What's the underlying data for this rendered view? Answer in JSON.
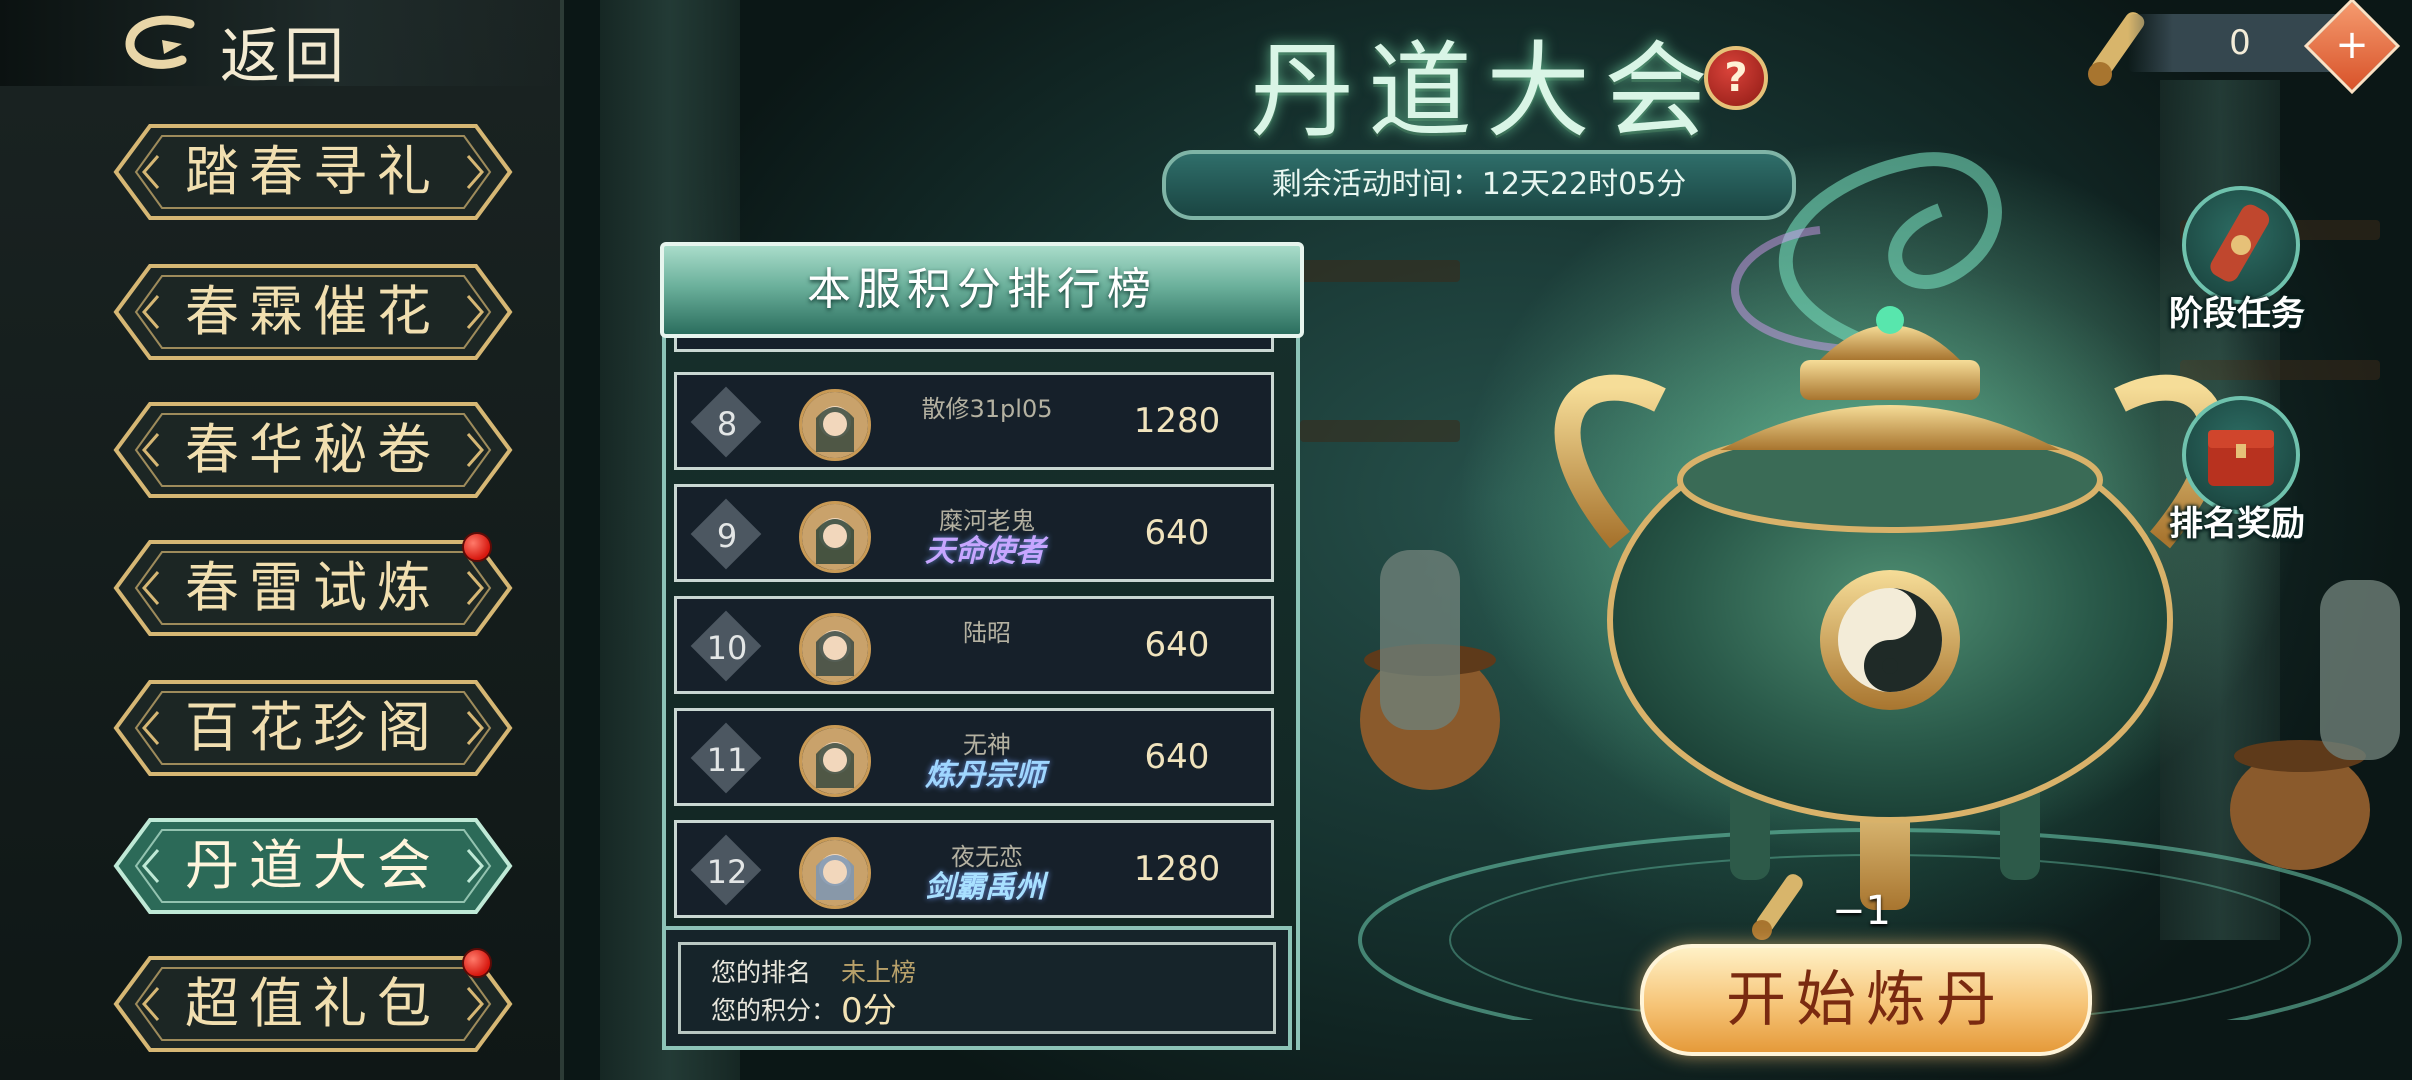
{
  "colors": {
    "accent_gold": "#e7c27a",
    "panel_teal": "#6cb19c",
    "notify_red": "#d7180f",
    "start_orange": "#f6c477"
  },
  "back": {
    "label": "返回"
  },
  "menu": [
    {
      "label": "踏春寻礼",
      "active": false,
      "badge": false
    },
    {
      "label": "春霖催花",
      "active": false,
      "badge": false
    },
    {
      "label": "春华秘卷",
      "active": false,
      "badge": false
    },
    {
      "label": "春雷试炼",
      "active": false,
      "badge": true
    },
    {
      "label": "百花珍阁",
      "active": false,
      "badge": false
    },
    {
      "label": "丹道大会",
      "active": true,
      "badge": false
    },
    {
      "label": "超值礼包",
      "active": false,
      "badge": true
    }
  ],
  "event": {
    "title": "丹道大会",
    "help": "?",
    "timer": "剩余活动时间：12天22时05分"
  },
  "currency": {
    "value": "0",
    "add_symbol": "+",
    "icon": "elixir-scroll-icon"
  },
  "side_buttons": {
    "stage_tasks": "阶段任务",
    "rank_rewards": "排名奖励"
  },
  "ranking": {
    "title": "本服积分排行榜",
    "rows": [
      {
        "rank": "8",
        "name": "散修31pl05",
        "title_badge": "",
        "score": "1280"
      },
      {
        "rank": "9",
        "name": "糜河老鬼",
        "title_badge": "天命使者",
        "score": "640"
      },
      {
        "rank": "10",
        "name": "陆昭",
        "title_badge": "",
        "score": "640"
      },
      {
        "rank": "11",
        "name": "无神",
        "title_badge": "炼丹宗师",
        "score": "640"
      },
      {
        "rank": "12",
        "name": "夜无恋",
        "title_badge": "剑霸禹州",
        "score": "1280"
      }
    ],
    "mine": {
      "rank_label": "您的排名",
      "rank_value": "未上榜",
      "score_label": "您的积分：",
      "score_value": "0分"
    }
  },
  "action": {
    "start_label": "开始炼丹",
    "cost": "−1"
  }
}
